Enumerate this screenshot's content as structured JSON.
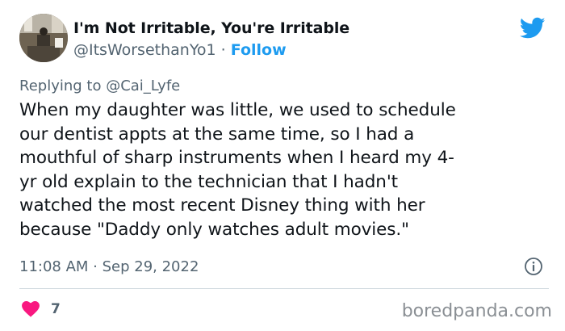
{
  "author": {
    "display_name": "I'm Not Irritable, You're Irritable",
    "handle": "@ItsWorsethanYo1",
    "separator": " · ",
    "follow_label": "Follow"
  },
  "reply": {
    "prefix": "Replying to ",
    "handle": "@Cai_Lyfe"
  },
  "tweet": {
    "text": "When my daughter was little, we used to schedule\nour dentist appts at the same time, so I had a\nmouthful of sharp instruments when I heard my 4-\nyr old explain to the technician that I hadn't\nwatched the most recent Disney thing with her\nbecause \"Daddy only watches adult movies.\"",
    "timestamp": "11:08 AM · Sep 29, 2022",
    "like_count": "7"
  },
  "watermark": "boredpanda.com",
  "colors": {
    "brand_blue": "#1d9bf0",
    "heart": "#f91880",
    "secondary_text": "#536471"
  },
  "icons": {
    "platform": "twitter-bird-icon",
    "info": "info-icon",
    "like": "heart-icon"
  }
}
